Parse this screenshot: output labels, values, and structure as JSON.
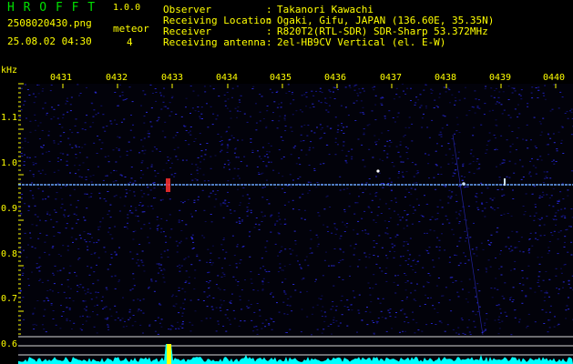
{
  "header": {
    "app_title": "H R O F F T",
    "app_version": "1.0.0",
    "file_name": "2508020430.png",
    "meteor_label": "meteor",
    "datetime": "25.08.02 04:30",
    "meteor_count": "4"
  },
  "info": [
    {
      "label": "Observer",
      "sep": ":",
      "value": "Takanori Kawachi"
    },
    {
      "label": "Receiving Location",
      "sep": ":",
      "value": "Ogaki, Gifu, JAPAN (136.60E, 35.35N)"
    },
    {
      "label": "Receiver",
      "sep": ":",
      "value": "R820T2(RTL-SDR) SDR-Sharp 53.372MHz"
    },
    {
      "label": "Receiving antenna",
      "sep": ":",
      "value": "2el-HB9CV Vertical (el. E-W)"
    }
  ],
  "axes": {
    "y_unit": "kHz",
    "time_ticks": [
      "0431",
      "0432",
      "0433",
      "0434",
      "0435",
      "0436",
      "0437",
      "0438",
      "0439",
      "0440"
    ],
    "freq_ticks": [
      "1.1",
      "1.0",
      "0.9",
      "0.8",
      "0.7",
      "0.6"
    ]
  },
  "colors": {
    "background": "#000000",
    "text_yellow": "#ffff00",
    "title_green": "#00e000",
    "noise_blue": "#1a1aa0",
    "carrier": "#6aa8ff",
    "meteor_red": "#ff3030",
    "spectrum_cyan": "#00ffff",
    "guide_line": "#d8d8d8"
  }
}
